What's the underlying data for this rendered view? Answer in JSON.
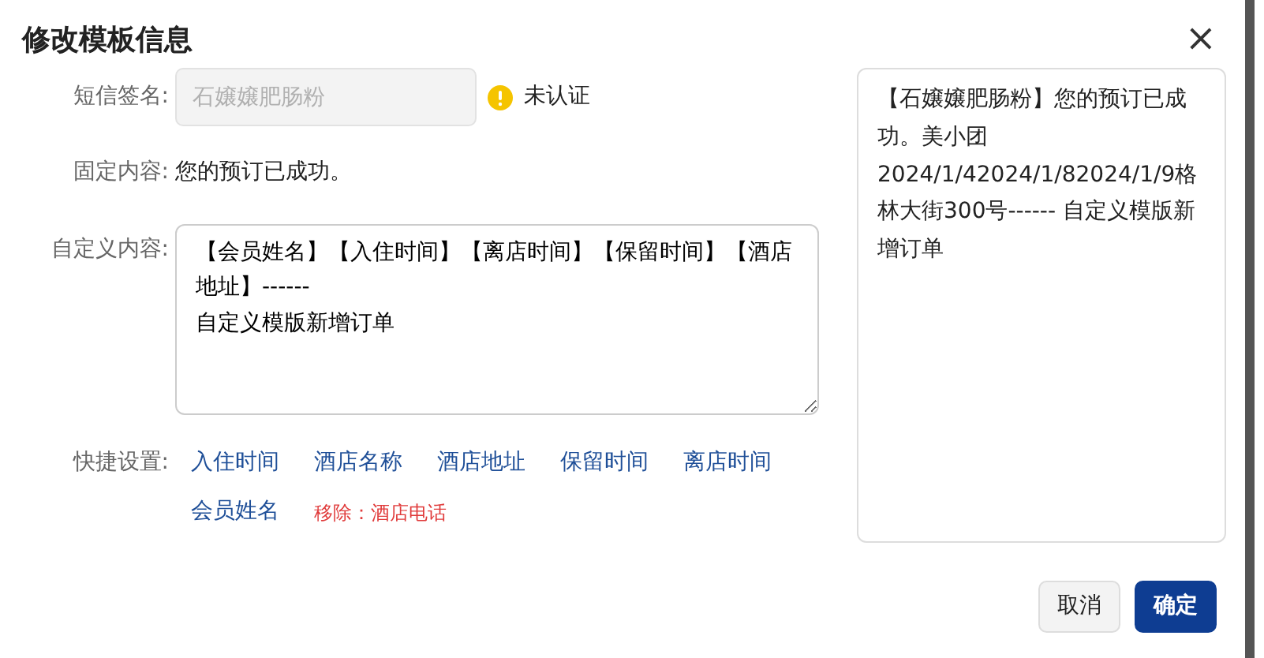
{
  "dialog": {
    "title": "修改模板信息",
    "close": "×"
  },
  "signature": {
    "label": "短信签名:",
    "value": "石嬢嬢肥肠粉",
    "disabled": true,
    "status": "未认证"
  },
  "fixed": {
    "label": "固定内容:",
    "text": "您的预订已成功。"
  },
  "custom": {
    "label": "自定义内容:",
    "value": "【会员姓名】【入住时间】【离店时间】【保留时间】【酒店地址】------\n自定义模版新增订单"
  },
  "shortcuts": {
    "label": "快捷设置:",
    "items": [
      {
        "kind": "insert",
        "text": "入住时间"
      },
      {
        "kind": "insert",
        "text": "酒店名称"
      },
      {
        "kind": "insert",
        "text": "酒店地址"
      },
      {
        "kind": "insert",
        "text": "保留时间"
      },
      {
        "kind": "insert",
        "text": "离店时间"
      },
      {
        "kind": "insert",
        "text": "会员姓名"
      },
      {
        "kind": "remove",
        "text": "移除：酒店电话"
      }
    ]
  },
  "preview": {
    "text": "【石嬢嬢肥肠粉】您的预订已成功。美小团 2024/1/42024/1/82024/1/9格林大街300号------ 自定义模版新增订单"
  },
  "buttons": [
    {
      "kind": "secondary",
      "text": "取消"
    },
    {
      "kind": "primary",
      "text": "确定"
    }
  ]
}
